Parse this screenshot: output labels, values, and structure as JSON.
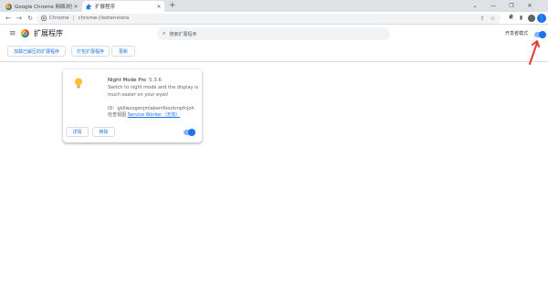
{
  "tabs": [
    {
      "label": "Google Chrome 网络浏览器",
      "active": false,
      "icon": "chrome-icon"
    },
    {
      "label": "扩展程序",
      "active": true,
      "icon": "puzzle-icon"
    }
  ],
  "window_controls": {
    "chevron": "⌄",
    "minimize": "—",
    "restore": "❐",
    "close": "✕"
  },
  "toolbar": {
    "site_label": "Chrome",
    "url": "chrome://extensions"
  },
  "header": {
    "title": "扩展程序",
    "search_placeholder": "搜索扩展程序",
    "dev_mode_label": "开发者模式",
    "dev_mode_on": true
  },
  "actions": {
    "load_unpacked": "加载已解压的扩展程序",
    "pack": "打包扩展程序",
    "update": "更新"
  },
  "extension": {
    "name": "Night Mode Pro",
    "version": "5.3.6",
    "description": "Switch to night mode and the display is much easier on your eyes!",
    "id_label": "ID：",
    "id_value": "gbllwoogenjmlabenlfoockmpfnjoh",
    "inspect_label": "检查视图",
    "inspect_link": "Service Worker（无效）",
    "details_button": "详情",
    "remove_button": "移除",
    "enabled": true
  },
  "colors": {
    "accent": "#1a73e8",
    "toggle_track": "#8ab4f8",
    "annotation": "#e53935"
  }
}
